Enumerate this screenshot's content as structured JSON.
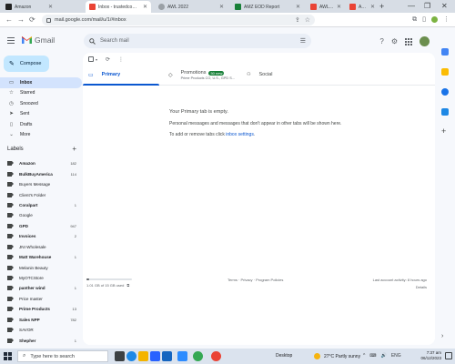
{
  "browser": {
    "tabs": [
      {
        "label": "Amazon",
        "active": false,
        "favicon_color": "#222222"
      },
      {
        "label": "Inbox - trustedcom120...",
        "active": true,
        "favicon_color": "#ea4335"
      },
      {
        "label": "AWL 2022",
        "active": false,
        "favicon_color": "#9aa0a6"
      },
      {
        "label": "AMZ EOD Report",
        "active": false,
        "favicon_color": "#188038"
      },
      {
        "label": "AWL LABEL - AWL LABEL",
        "active": false,
        "favicon_color": "#ea4335"
      },
      {
        "label": "AWL LABEL",
        "active": false,
        "favicon_color": "#ea4335"
      }
    ],
    "new_tab_glyph": "+",
    "window_controls": {
      "minimize": "—",
      "restore": "❐",
      "close": "✕"
    },
    "nav": {
      "back": "←",
      "forward": "→",
      "reload": "⟳"
    },
    "url": "mail.google.com/mail/u/1/#inbox",
    "omnibox_icons": [
      "share-icon",
      "star-icon"
    ],
    "extension_icons": [
      "extension-icon",
      "sidebar-icon",
      "profile-icon",
      "menu-icon"
    ]
  },
  "gmail": {
    "product_name": "Gmail",
    "search_placeholder": "Search mail",
    "header_icons": {
      "help": "?",
      "settings": "⚙"
    },
    "compose_label": "Compose",
    "nav": [
      {
        "label": "Inbox",
        "icon": "inbox-icon",
        "glyph": "▭",
        "active": true
      },
      {
        "label": "Starred",
        "icon": "star-icon",
        "glyph": "☆",
        "active": false
      },
      {
        "label": "Snoozed",
        "icon": "clock-icon",
        "glyph": "◷",
        "active": false
      },
      {
        "label": "Sent",
        "icon": "send-icon",
        "glyph": "➤",
        "active": false
      },
      {
        "label": "Drafts",
        "icon": "draft-icon",
        "glyph": "▯",
        "active": false
      },
      {
        "label": "More",
        "icon": "chevron-down-icon",
        "glyph": "⌄",
        "active": false
      }
    ],
    "labels_heading": "Labels",
    "labels_add": "+",
    "labels": [
      {
        "name": "Amazon",
        "count": "182",
        "bold": true
      },
      {
        "name": "BulkBuyAmerica",
        "count": "114",
        "bold": true
      },
      {
        "name": "Buyers Message",
        "count": "",
        "bold": false
      },
      {
        "name": "Client's Folder",
        "count": "",
        "bold": false
      },
      {
        "name": "Coralpart",
        "count": "1",
        "bold": true
      },
      {
        "name": "Google",
        "count": "",
        "bold": false
      },
      {
        "name": "GPD",
        "count": "947",
        "bold": true
      },
      {
        "name": "Invoices",
        "count": "2",
        "bold": true
      },
      {
        "name": "JNI Wholesale",
        "count": "",
        "bold": false
      },
      {
        "name": "Matt Warehouse",
        "count": "1",
        "bold": true
      },
      {
        "name": "Melanin Beauty",
        "count": "",
        "bold": false
      },
      {
        "name": "MyOTCStore",
        "count": "",
        "bold": false
      },
      {
        "name": "panther wind",
        "count": "1",
        "bold": true
      },
      {
        "name": "Price master",
        "count": "",
        "bold": false
      },
      {
        "name": "Prime Products",
        "count": "13",
        "bold": true
      },
      {
        "name": "Sales NPP",
        "count": "782",
        "bold": true
      },
      {
        "name": "SAVOR",
        "count": "",
        "bold": false
      },
      {
        "name": "Shepher",
        "count": "1",
        "bold": true
      },
      {
        "name": "Shippo",
        "count": "3",
        "bold": true
      }
    ],
    "toolbar": {
      "select_glyph": "▾",
      "refresh_glyph": "⟳",
      "more_glyph": "⋮"
    },
    "tabs": {
      "primary": {
        "label": "Primary",
        "glyph": "▭"
      },
      "promotions": {
        "label": "Promotions",
        "badge": "50 new",
        "snippet": "Prime Products CO, U.S., GPD S...",
        "glyph": "◇"
      },
      "social": {
        "label": "Social",
        "glyph": "👥"
      }
    },
    "empty_state": {
      "title": "Your Primary tab is empty.",
      "line1": "Personal messages and messages that don't appear in other tabs will be shown here.",
      "line2_prefix": "To add or remove tabs click ",
      "line2_link": "inbox settings",
      "line2_suffix": "."
    },
    "footer": {
      "storage_text": "1.01 GB of 15 GB used",
      "storage_fraction": 0.067,
      "terms": "Terms · Privacy · Program Policies",
      "activity": "Last account activity: 8 hours ago",
      "details": "Details"
    }
  },
  "taskbar": {
    "search_placeholder": "Type here to search",
    "pinned_apps": [
      {
        "name": "task-view-icon",
        "color": "#3c4043"
      },
      {
        "name": "edge-icon",
        "color": "#1e88e5"
      },
      {
        "name": "file-explorer-icon",
        "color": "#f4b400"
      },
      {
        "name": "store-icon",
        "color": "#2962ff"
      },
      {
        "name": "mail-icon",
        "color": "#1565c0"
      },
      {
        "name": "zoom-icon",
        "color": "#2d8cff"
      },
      {
        "name": "chrome-icon",
        "color": "#34a853"
      },
      {
        "name": "chrome-profile-icon",
        "color": "#ea4335"
      }
    ],
    "desktop_label": "Desktop",
    "weather": "27°C Partly sunny",
    "tray": [
      "^",
      "⌨",
      "🔊",
      "ENG"
    ],
    "time": "7:37 am",
    "date": "06/12/2023"
  }
}
